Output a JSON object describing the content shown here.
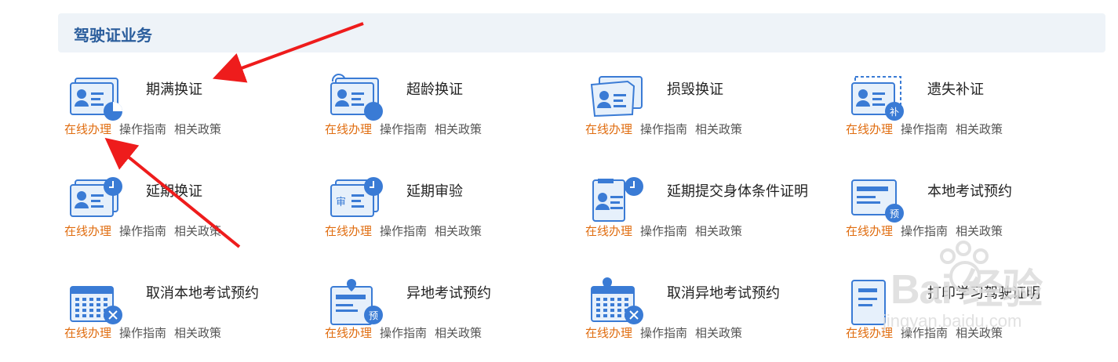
{
  "section": {
    "title": "驾驶证业务"
  },
  "colors": {
    "accent": "#2a5d9c",
    "online_link": "#e06d10",
    "icon_blue": "#3a7bd5"
  },
  "link_labels": {
    "online": "在线办理",
    "guide": "操作指南",
    "policy": "相关政策"
  },
  "services": [
    {
      "title": "期满换证",
      "icon": "id-card-pie-icon"
    },
    {
      "title": "超龄换证",
      "icon": "id-card-refresh-icon"
    },
    {
      "title": "损毁换证",
      "icon": "damaged-card-icon"
    },
    {
      "title": "遗失补证",
      "icon": "lost-card-replace-icon"
    },
    {
      "title": "延期换证",
      "icon": "id-card-clock-icon"
    },
    {
      "title": "延期审验",
      "icon": "audit-card-clock-icon"
    },
    {
      "title": "延期提交身体条件证明",
      "icon": "health-cert-clock-icon"
    },
    {
      "title": "本地考试预约",
      "icon": "exam-booking-icon"
    },
    {
      "title": "取消本地考试预约",
      "icon": "calendar-cancel-icon"
    },
    {
      "title": "异地考试预约",
      "icon": "remote-exam-booking-icon"
    },
    {
      "title": "取消异地考试预约",
      "icon": "remote-calendar-cancel-icon"
    },
    {
      "title": "打印学习驾驶证明",
      "icon": "print-certificate-icon"
    }
  ],
  "watermark": {
    "brand": "Bai 经验",
    "url": "jingyan.baidu.com"
  }
}
